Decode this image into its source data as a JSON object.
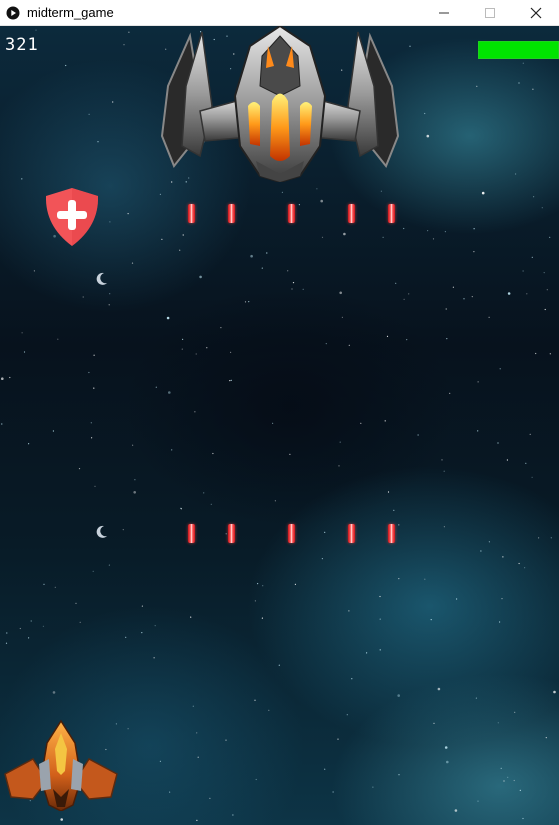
{
  "window": {
    "title": "midterm_game",
    "controls": {
      "minimize": "minimize-icon",
      "maximize": "maximize-icon",
      "close": "close-icon"
    }
  },
  "hud": {
    "score": "321",
    "health_fraction": 1.0,
    "health_color": "#00e400"
  },
  "sprites": {
    "boss": "enemy-boss-ship",
    "player": "player-ship",
    "powerup": "health-shield-plus",
    "bullet_color": "#e01e24"
  }
}
